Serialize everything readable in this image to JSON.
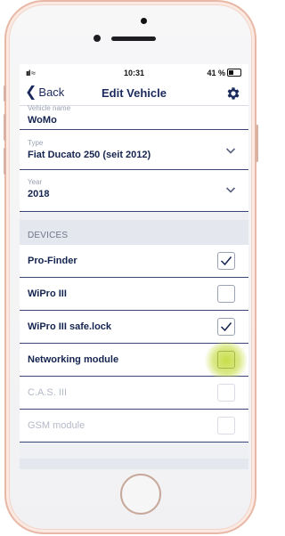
{
  "status_bar": {
    "time": "10:31",
    "signal": "ııl",
    "battery": "41 %"
  },
  "nav": {
    "back_label": "Back",
    "title": "Edit Vehicle",
    "settings_icon": "gear-icon"
  },
  "vehicle": {
    "name": {
      "label": "Vehicle name",
      "value": "WoMo"
    },
    "type": {
      "label": "Type",
      "value": "Fiat Ducato 250 (seit 2012)"
    },
    "year": {
      "label": "Year",
      "value": "2018"
    }
  },
  "devices": {
    "header": "DEVICES",
    "items": [
      {
        "label": "Pro-Finder",
        "checked": true,
        "enabled": true
      },
      {
        "label": "WiPro III",
        "checked": false,
        "enabled": true
      },
      {
        "label": "WiPro III safe.lock",
        "checked": true,
        "enabled": true
      },
      {
        "label": "Networking module",
        "checked": false,
        "enabled": true
      },
      {
        "label": "C.A.S. III",
        "checked": false,
        "enabled": false
      },
      {
        "label": "GSM module",
        "checked": false,
        "enabled": false
      }
    ]
  },
  "colors": {
    "accent": "#14244f",
    "divider": "#3a4676",
    "touch": "#bed728"
  }
}
